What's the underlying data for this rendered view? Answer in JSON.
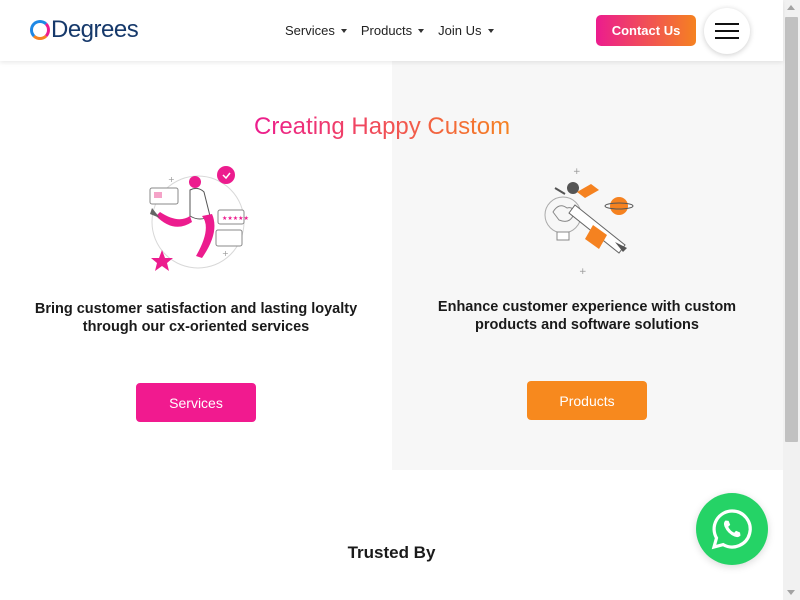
{
  "header": {
    "logo_text": "Degrees",
    "nav": [
      {
        "label": "Services"
      },
      {
        "label": "Products"
      },
      {
        "label": "Join Us"
      }
    ],
    "contact_label": "Contact Us"
  },
  "hero": {
    "title": "Creating Happy Custom",
    "left": {
      "text": "Bring customer satisfaction and lasting loyalty through our cx-oriented services",
      "button_label": "Services"
    },
    "right": {
      "text": "Enhance customer experience with custom products and software solutions",
      "button_label": "Products"
    }
  },
  "trusted": {
    "title": "Trusted By"
  },
  "icons": {
    "whatsapp": "whatsapp-icon",
    "menu": "hamburger-icon"
  },
  "colors": {
    "pink": "#ec1c8e",
    "orange": "#f58220",
    "navy": "#16396b",
    "whatsapp": "#25d366"
  }
}
